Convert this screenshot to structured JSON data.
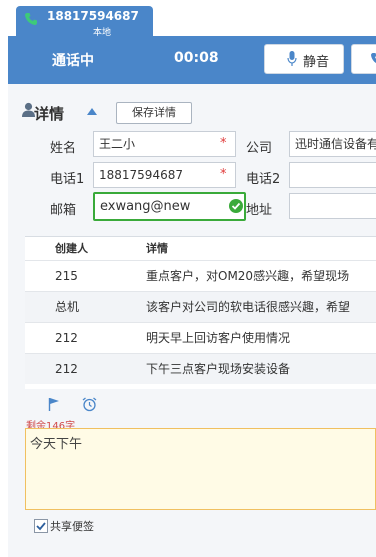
{
  "tab": {
    "number": "18817594687",
    "sub": "本地"
  },
  "callbar": {
    "status": "通话中",
    "timer": "00:08",
    "mute_label": "静音"
  },
  "details": {
    "title": "详情",
    "save_label": "保存详情",
    "fields": {
      "name_label": "姓名",
      "name_value": "王二小",
      "company_label": "公司",
      "company_value": "迅时通信设备有",
      "phone1_label": "电话1",
      "phone1_value": "18817594687",
      "phone2_label": "电话2",
      "phone2_value": "",
      "email_label": "邮箱",
      "email_value": "exwang@new",
      "address_label": "地址",
      "address_value": ""
    },
    "required_mark": "*"
  },
  "table": {
    "headers": [
      "创建人",
      "详情"
    ],
    "rows": [
      [
        "215",
        "重点客户，对OM20感兴趣，希望现场"
      ],
      [
        "总机",
        "该客户对公司的软电话很感兴趣，希望"
      ],
      [
        "212",
        "明天早上回访客户使用情况"
      ],
      [
        "212",
        "下午三点客户现场安装设备"
      ]
    ]
  },
  "notes": {
    "remaining": "剩余146字",
    "text": "今天下午",
    "share_label": "共享便签"
  },
  "colors": {
    "accent": "#4a86c9",
    "valid": "#3aaa3a",
    "required": "#e03a3a"
  }
}
